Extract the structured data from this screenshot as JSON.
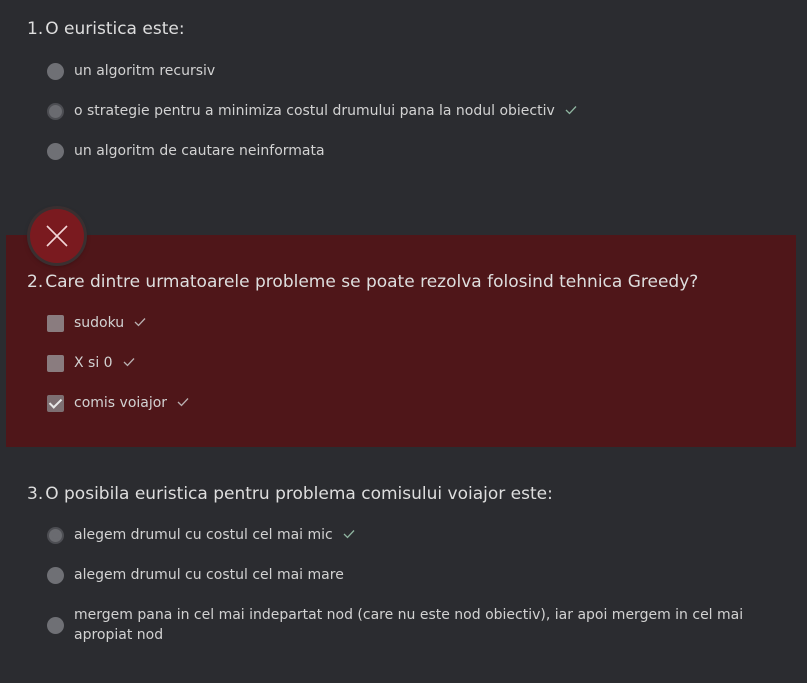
{
  "questions": [
    {
      "number": "1.",
      "text": "O euristica este:",
      "type": "radio",
      "options": [
        {
          "label": "un algoritm recursiv",
          "selected": false,
          "correct": false
        },
        {
          "label": "o strategie pentru a minimiza costul drumului pana la nodul obiectiv",
          "selected": true,
          "correct": true
        },
        {
          "label": "un algoritm de cautare neinformata",
          "selected": false,
          "correct": false
        }
      ]
    },
    {
      "number": "2.",
      "text": "Care dintre urmatoarele probleme se poate rezolva folosind tehnica Greedy?",
      "type": "checkbox",
      "status": "wrong",
      "options": [
        {
          "label": "sudoku",
          "selected": false,
          "correct": true
        },
        {
          "label": "X si 0",
          "selected": false,
          "correct": true
        },
        {
          "label": "comis voiajor",
          "selected": true,
          "correct": true
        }
      ]
    },
    {
      "number": "3.",
      "text": "O posibila euristica pentru problema comisului voiajor este:",
      "type": "radio",
      "options": [
        {
          "label": "alegem drumul cu costul cel mai mic",
          "selected": true,
          "correct": true
        },
        {
          "label": "alegem drumul cu costul cel mai mare",
          "selected": false,
          "correct": false
        },
        {
          "label": "mergem pana in cel mai indepartat nod (care nu este nod obiectiv), iar apoi mergem in cel mai apropiat nod",
          "selected": false,
          "correct": false
        }
      ]
    }
  ],
  "icons": {
    "tick": "check-icon",
    "wrong": "close-icon"
  },
  "colors": {
    "background": "#2b2c30",
    "wrong_panel": "#4f1619",
    "wrong_badge": "#7a1a1f",
    "tick": "#8fb5a0"
  }
}
